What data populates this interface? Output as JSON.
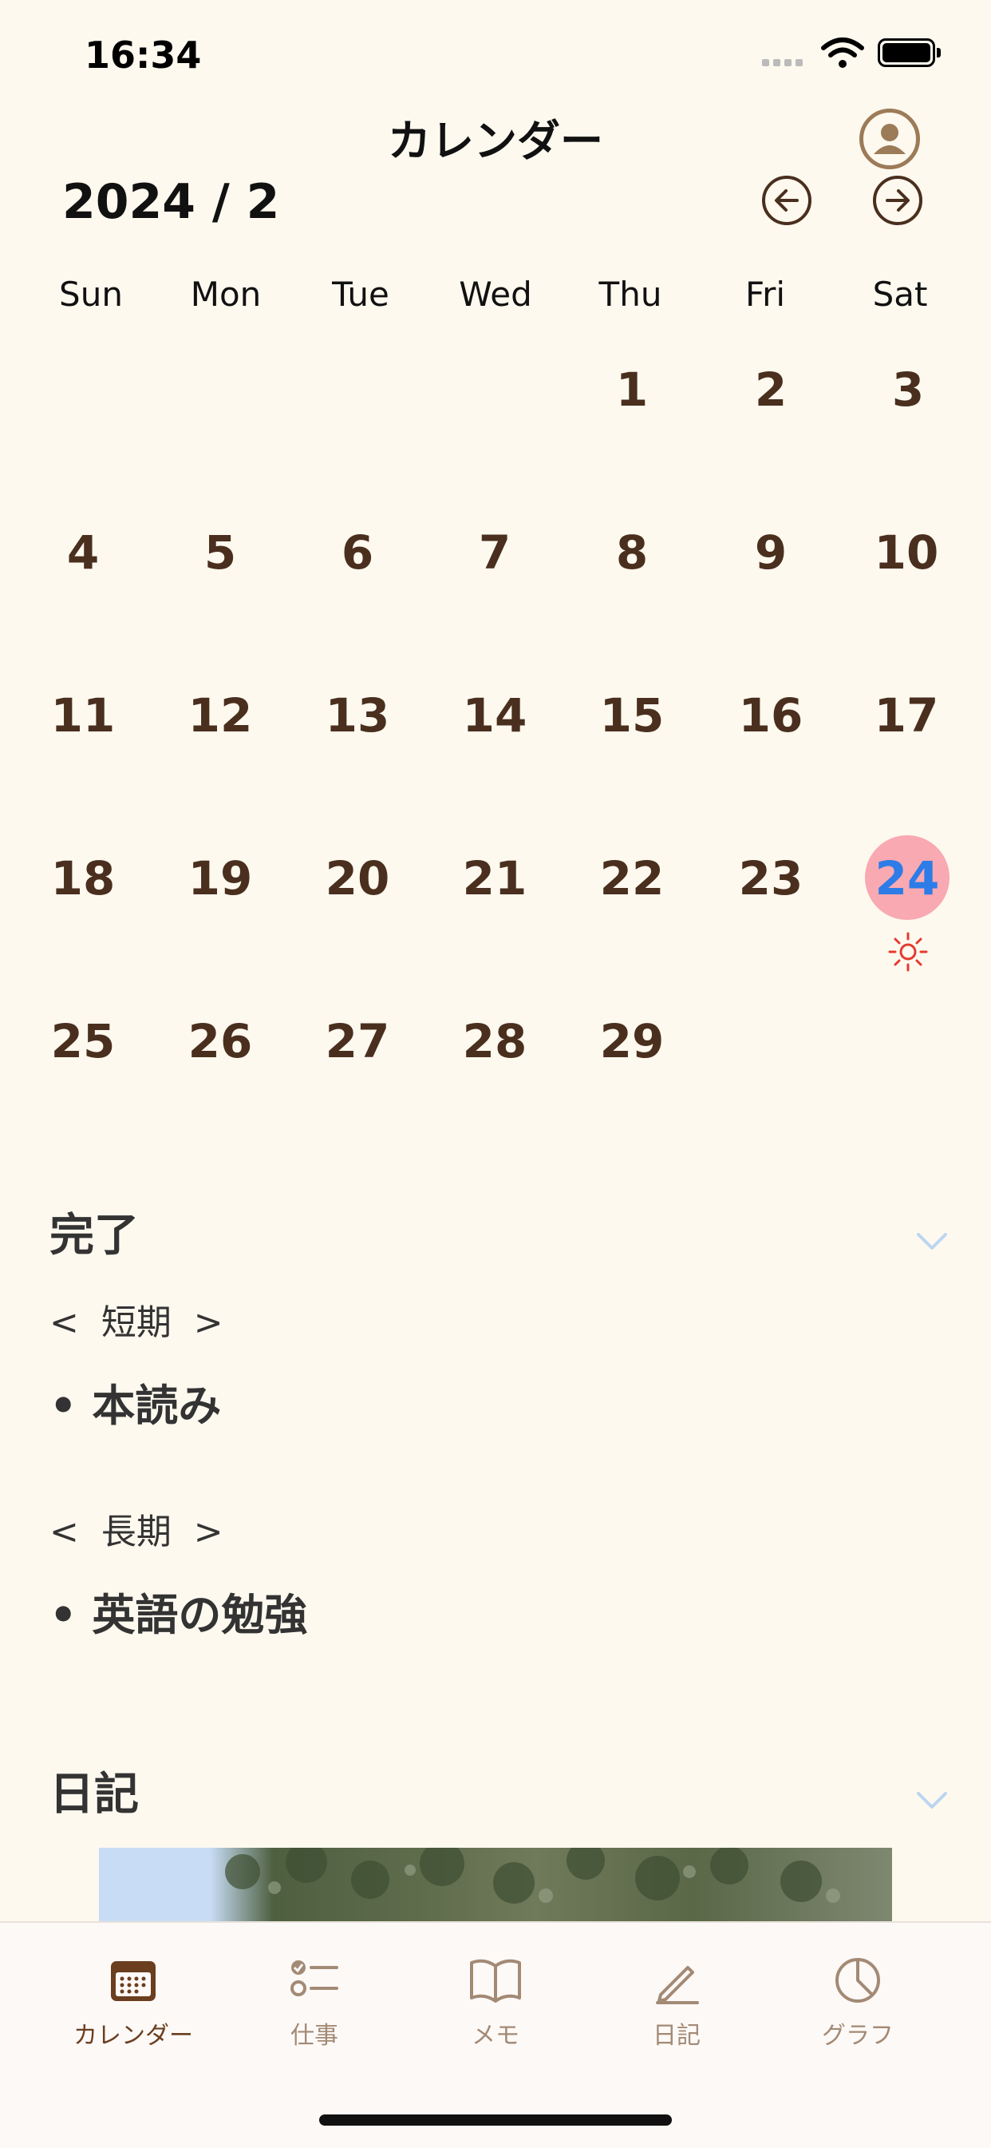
{
  "status_bar": {
    "time": "16:34"
  },
  "header": {
    "title": "カレンダー"
  },
  "calendar": {
    "month_label": "2024 / 2",
    "weekdays": [
      "Sun",
      "Mon",
      "Tue",
      "Wed",
      "Thu",
      "Fri",
      "Sat"
    ],
    "days": [
      "1",
      "2",
      "3",
      "4",
      "5",
      "6",
      "7",
      "8",
      "9",
      "10",
      "11",
      "12",
      "13",
      "14",
      "15",
      "16",
      "17",
      "18",
      "19",
      "20",
      "21",
      "22",
      "23",
      "24",
      "25",
      "26",
      "27",
      "28",
      "29"
    ],
    "today": "24",
    "today_weather_icon": "sun-icon",
    "accent_color": "#F9A9B1",
    "today_text_color": "#2D7CE8"
  },
  "completed": {
    "title": "完了",
    "short_term_label": "<  短期  >",
    "short_term_items": [
      "• 本読み"
    ],
    "long_term_label": "<  長期  >",
    "long_term_items": [
      "• 英語の勉強"
    ]
  },
  "diary": {
    "title": "日記"
  },
  "tabs": [
    {
      "label": "カレンダー",
      "icon": "calendar-icon",
      "active": true
    },
    {
      "label": "仕事",
      "icon": "checklist-icon",
      "active": false
    },
    {
      "label": "メモ",
      "icon": "book-icon",
      "active": false
    },
    {
      "label": "日記",
      "icon": "pencil-icon",
      "active": false
    },
    {
      "label": "グラフ",
      "icon": "pie-chart-icon",
      "active": false
    }
  ]
}
